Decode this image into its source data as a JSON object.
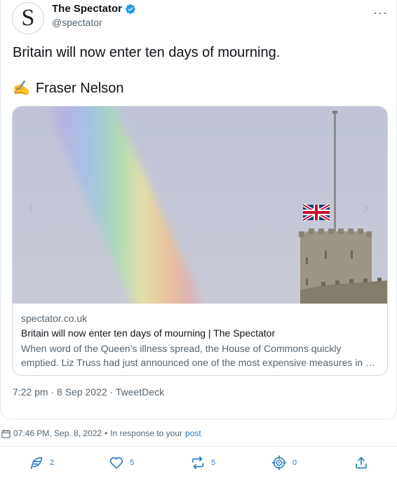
{
  "tweet": {
    "avatar_letter": "S",
    "display_name": "The Spectator",
    "handle": "@spectator",
    "more_label": "···",
    "text": "Britain will now enter ten days of mourning.",
    "byline_emoji": "✍️",
    "byline_name": "Fraser Nelson",
    "timestamp": "7:22 pm · 8 Sep 2022",
    "timestamp_sep": " · ",
    "source": "TweetDeck"
  },
  "link_card": {
    "domain": "spectator.co.uk",
    "title": "Britain will now enter ten days of mourning | The Spectator",
    "description": "When word of the Queen’s illness spread, the House of Commons quickly emptied. Liz Truss had just announced one of the most expensive measures in …",
    "prev_arrow": "‹",
    "next_arrow": "›"
  },
  "meta": {
    "datetime": "07:46 PM, Sep. 8, 2022",
    "bullet": "•",
    "response_text": "In response to your",
    "response_link": "post"
  },
  "actions": {
    "reply_count": "2",
    "like_count": "5",
    "retweet_count": "5",
    "target_count": "0"
  },
  "colors": {
    "verified": "#1d9bf0",
    "action_blue": "#2b7bc1",
    "link_blue": "#1d7bbf"
  }
}
